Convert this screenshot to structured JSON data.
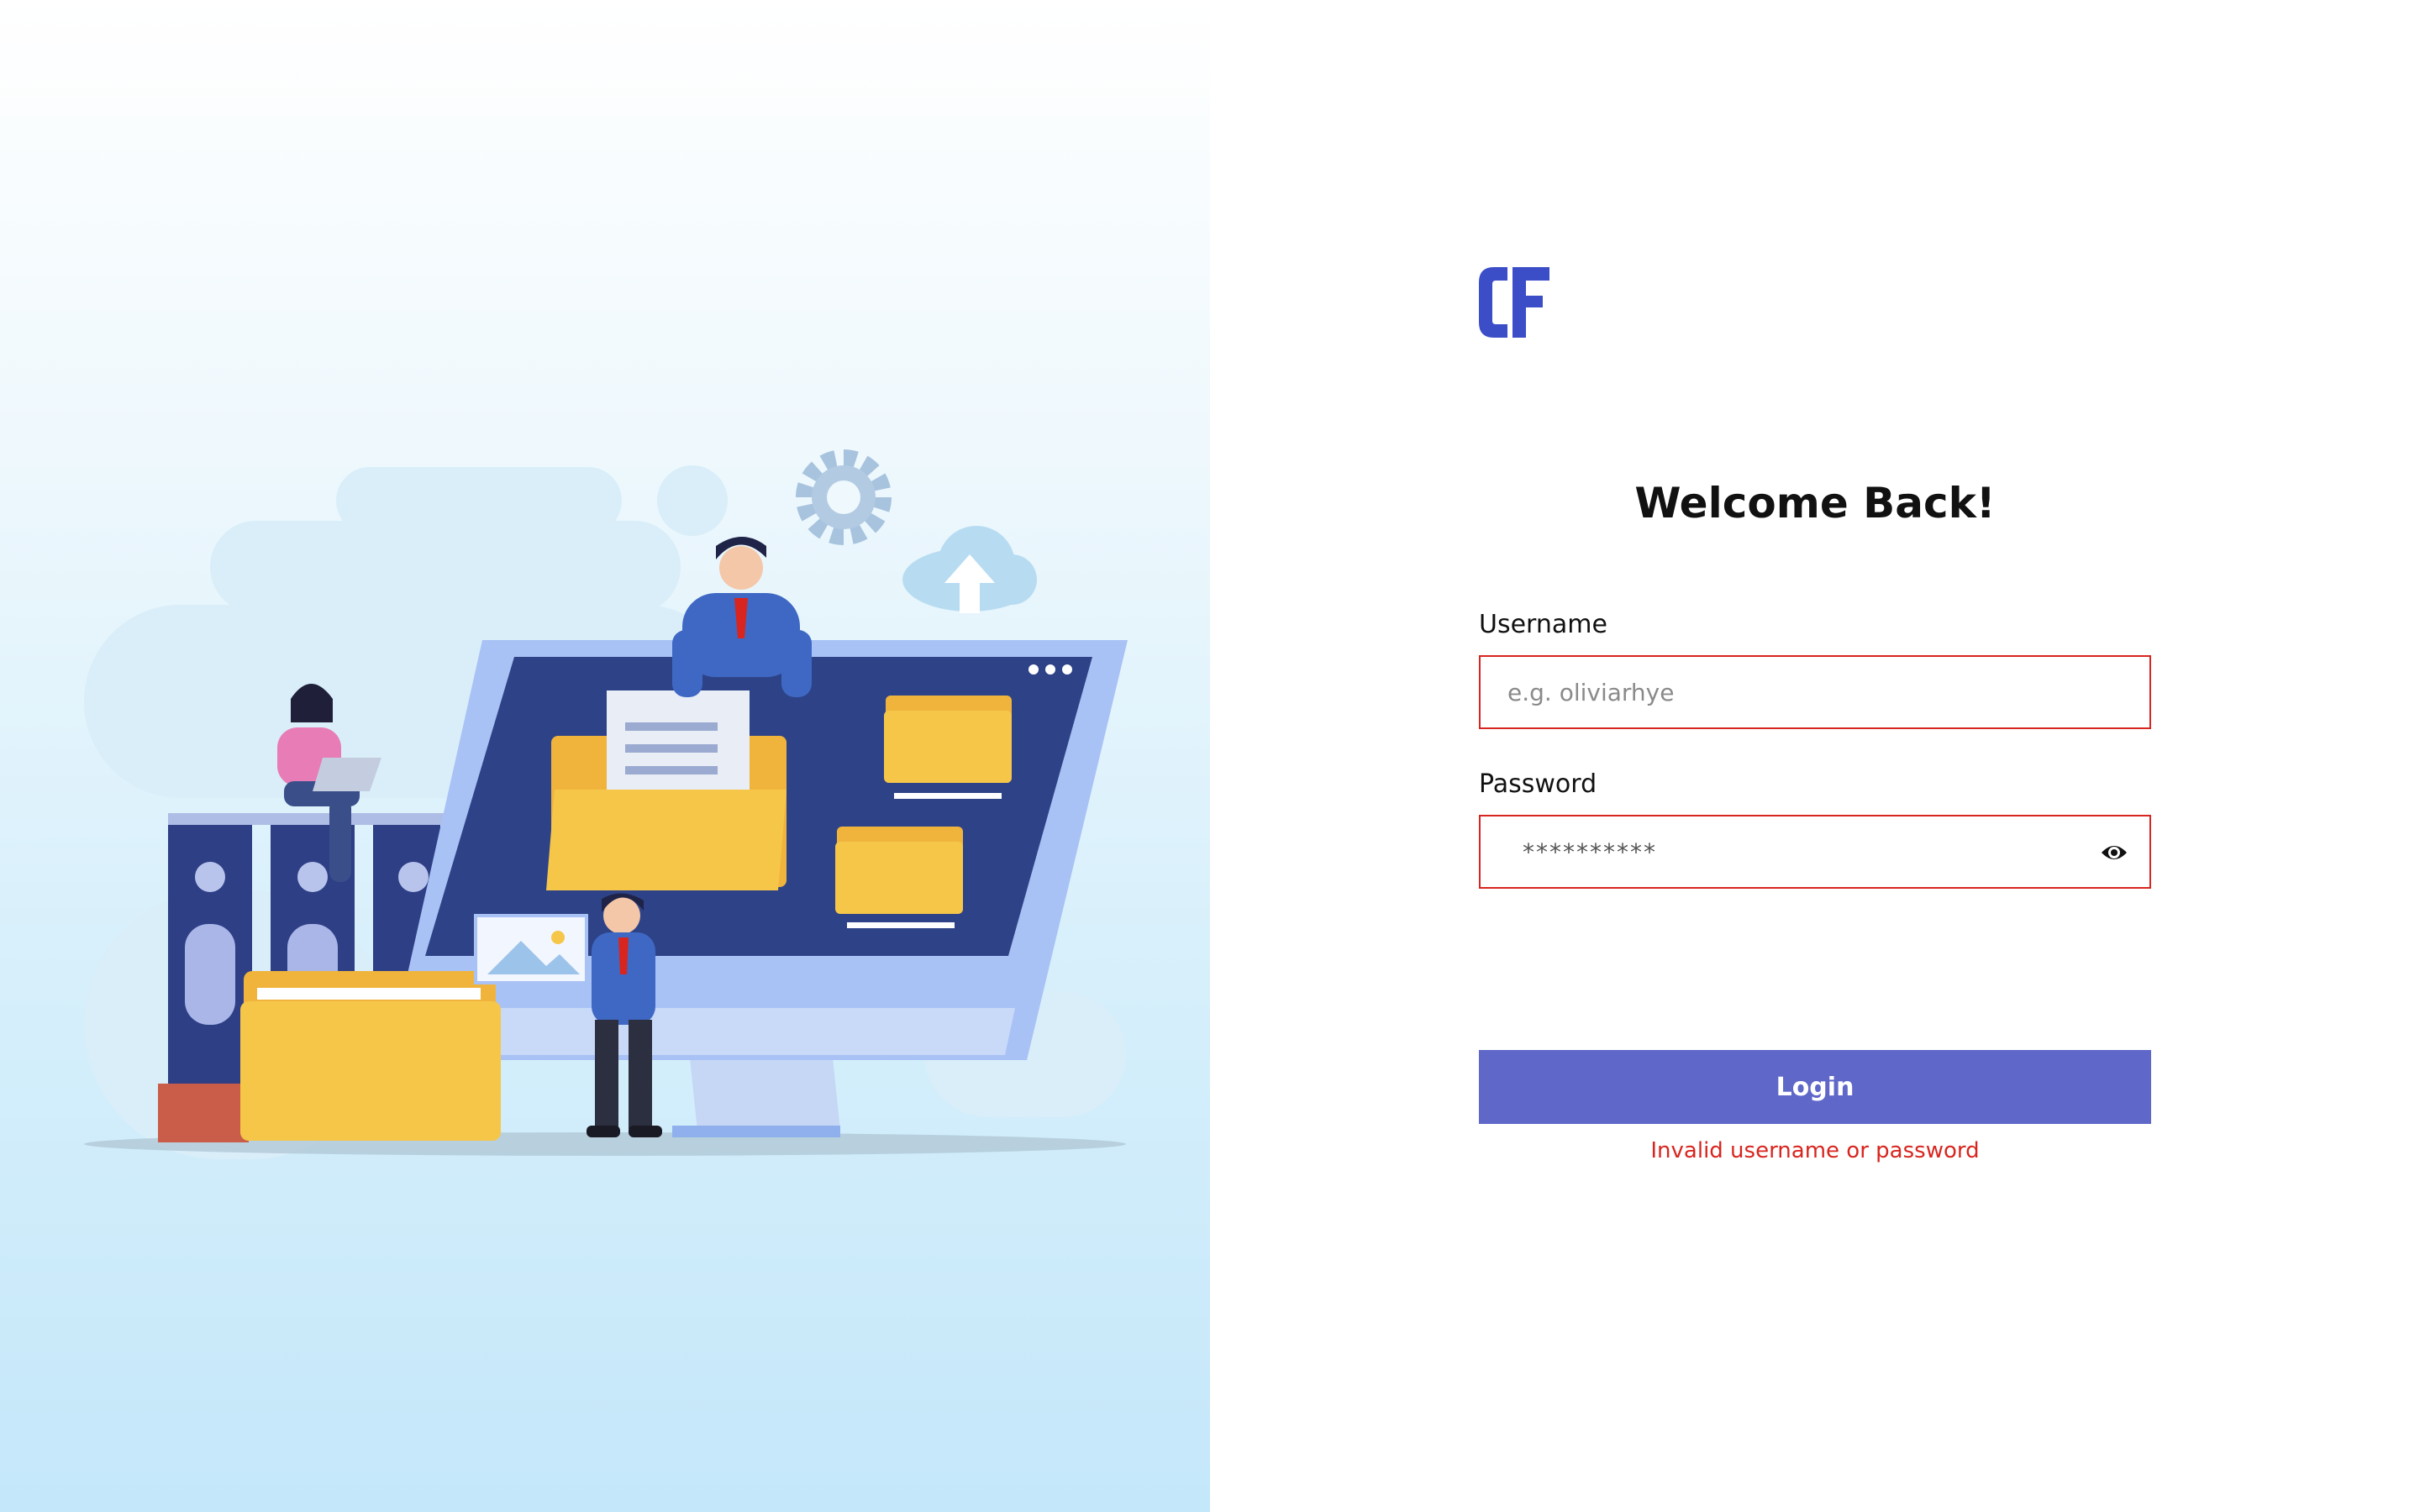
{
  "login": {
    "logo_text": "CF",
    "title": "Welcome Back!",
    "username_label": "Username",
    "username_placeholder": "e.g. oliviarhye",
    "username_value": "",
    "password_label": "Password",
    "password_placeholder": "**********",
    "password_value": "",
    "password_toggle_icon": "eye-icon",
    "submit_label": "Login",
    "error_message": "Invalid username or password"
  },
  "colors": {
    "brand": "#3b4ec8",
    "button": "#5f67c9",
    "error": "#d8251f",
    "left_panel_top": "#ffffff",
    "left_panel_bottom": "#c4e7fa"
  },
  "icons": {
    "illustration": "file-management-illustration",
    "password_toggle": "eye-icon"
  }
}
